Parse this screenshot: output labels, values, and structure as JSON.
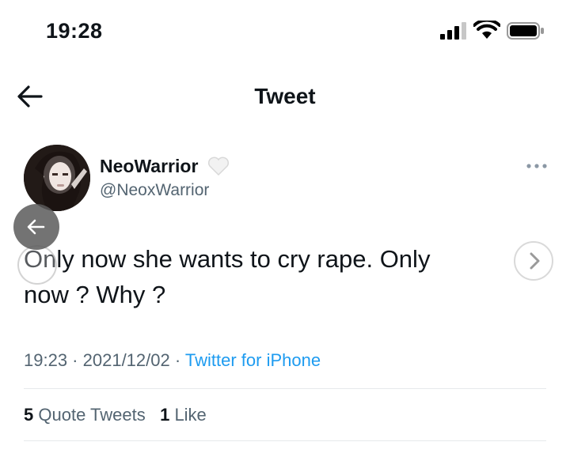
{
  "status_bar": {
    "time": "19:28"
  },
  "header": {
    "title": "Tweet"
  },
  "author": {
    "display_name": "NeoWarrior",
    "handle": "@NeoxWarrior"
  },
  "tweet": {
    "text_line1": "Only now she wants to cry rape. Only",
    "text_line2": "now ? Why ?"
  },
  "meta": {
    "time": "19:23",
    "sep1": " · ",
    "date": "2021/12/02",
    "sep2": " · ",
    "source": "Twitter for iPhone"
  },
  "stats": {
    "quote_count": "5",
    "quote_label": "Quote Tweets",
    "like_count": "1",
    "like_label": "Like"
  },
  "icons": {
    "back": "back-arrow-icon",
    "more": "more-dots-icon",
    "heart": "white-heart-emoji",
    "carousel_prev": "chevron-left-icon",
    "carousel_next": "chevron-right-icon"
  },
  "colors": {
    "link": "#1d9bf0",
    "secondary": "#536471",
    "text": "#0f1419"
  }
}
